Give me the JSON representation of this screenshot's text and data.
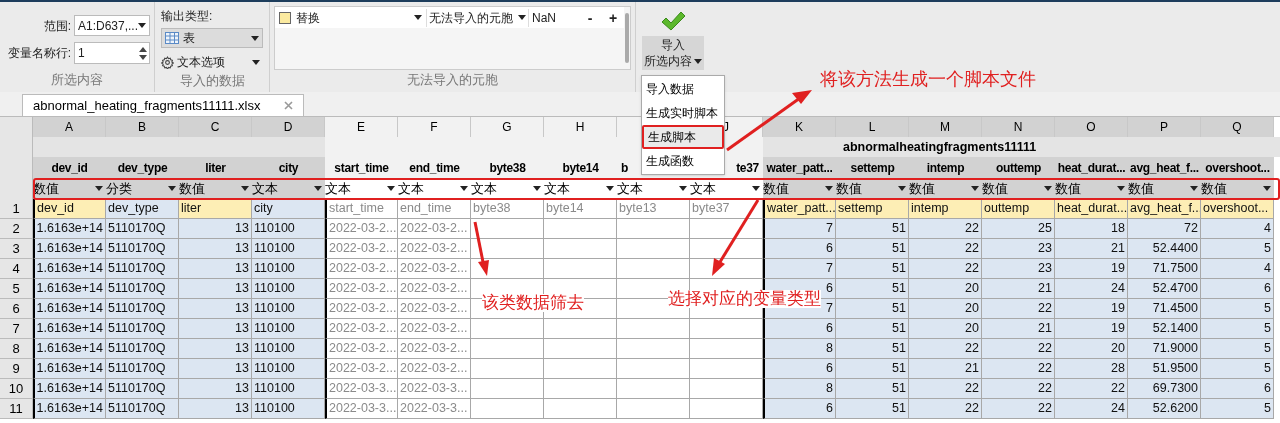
{
  "selection": {
    "title": "所选内容",
    "range_label": "范围:",
    "range_value": "A1:D637,...",
    "varnames_label": "变量名称行:",
    "varnames_value": "1"
  },
  "imported_data": {
    "title": "导入的数据",
    "output_label": "输出类型:",
    "output_value": "表",
    "text_options": "文本选项"
  },
  "unimportable": {
    "title": "无法导入的元胞",
    "rules": [
      {
        "action": "替换",
        "target": "无法导入的元胞",
        "value": "NaN",
        "color": "#fbeaa0"
      }
    ],
    "minus": "-",
    "plus": "+"
  },
  "import_button": {
    "line1": "导入",
    "line2": "所选内容"
  },
  "import_menu": {
    "items": [
      {
        "label": "导入数据",
        "selected": false
      },
      {
        "label": "生成实时脚本",
        "selected": false
      },
      {
        "label": "生成脚本",
        "selected": true
      },
      {
        "label": "生成函数",
        "selected": false
      }
    ]
  },
  "file_tabs": [
    {
      "label": "abnormal_heating_fragments11111.xlsx",
      "selected": true
    }
  ],
  "table": {
    "title": "abnormalheatingfragments11111",
    "columns": [
      {
        "letter": "A",
        "name": "dev_id",
        "type": "数值",
        "kind": "numeric",
        "selected": true
      },
      {
        "letter": "B",
        "name": "dev_type",
        "type": "分类",
        "kind": "text",
        "selected": true
      },
      {
        "letter": "C",
        "name": "liter",
        "type": "数值",
        "kind": "numeric",
        "selected": true
      },
      {
        "letter": "D",
        "name": "city",
        "type": "文本",
        "kind": "text",
        "selected": true
      },
      {
        "letter": "E",
        "name": "start_time",
        "type": "文本",
        "kind": "text",
        "selected": false
      },
      {
        "letter": "F",
        "name": "end_time",
        "type": "文本",
        "kind": "text",
        "selected": false
      },
      {
        "letter": "G",
        "name": "byte38",
        "type": "文本",
        "kind": "text",
        "selected": false
      },
      {
        "letter": "H",
        "name": "byte14",
        "type": "文本",
        "kind": "text",
        "selected": false
      },
      {
        "name": "b",
        "type": "文本",
        "kind": "text",
        "selected": false
      },
      {
        "letter": "J",
        "name": "te37",
        "type": "文本",
        "kind": "text",
        "selected": false
      },
      {
        "letter": "K",
        "name": "water_patt...",
        "type": "数值",
        "kind": "numeric",
        "selected": true
      },
      {
        "letter": "L",
        "name": "settemp",
        "type": "数值",
        "kind": "numeric",
        "selected": true
      },
      {
        "letter": "M",
        "name": "intemp",
        "type": "数值",
        "kind": "numeric",
        "selected": true
      },
      {
        "letter": "N",
        "name": "outtemp",
        "type": "数值",
        "kind": "numeric",
        "selected": true
      },
      {
        "letter": "O",
        "name": "heat_durat...",
        "type": "数值",
        "kind": "numeric",
        "selected": true
      },
      {
        "letter": "P",
        "name": "avg_heat_f...",
        "type": "数值",
        "kind": "numeric",
        "selected": true
      },
      {
        "letter": "Q",
        "name": "overshoot...",
        "type": "数值",
        "kind": "numeric",
        "selected": true
      }
    ],
    "rows": [
      {
        "number": "1",
        "kind": "names",
        "cells": [
          "dev_id",
          "dev_type",
          "liter",
          "city",
          "start_time",
          "end_time",
          "byte38",
          "byte14",
          "byte13",
          "byte37",
          "water_patt...",
          "settemp",
          "intemp",
          "outtemp",
          "heat_durat...",
          "avg_heat_f...",
          "overshoot..."
        ]
      },
      {
        "number": "2",
        "kind": "data",
        "cells": [
          "1.6163e+14",
          "5110170Q",
          "13",
          "110100",
          "2022-03-2...",
          "2022-03-2...",
          null,
          null,
          null,
          null,
          "7",
          "51",
          "22",
          "25",
          "18",
          "72",
          "4"
        ]
      },
      {
        "number": "3",
        "kind": "data",
        "cells": [
          "1.6163e+14",
          "5110170Q",
          "13",
          "110100",
          "2022-03-2...",
          "2022-03-2...",
          null,
          null,
          null,
          null,
          "6",
          "51",
          "22",
          "23",
          "21",
          "52.4400",
          "5"
        ]
      },
      {
        "number": "4",
        "kind": "data",
        "cells": [
          "1.6163e+14",
          "5110170Q",
          "13",
          "110100",
          "2022-03-2...",
          "2022-03-2...",
          null,
          null,
          null,
          null,
          "7",
          "51",
          "22",
          "23",
          "19",
          "71.7500",
          "4"
        ]
      },
      {
        "number": "5",
        "kind": "data",
        "cells": [
          "1.6163e+14",
          "5110170Q",
          "13",
          "110100",
          "2022-03-2...",
          "2022-03-2...",
          null,
          null,
          null,
          null,
          "6",
          "51",
          "20",
          "21",
          "24",
          "52.4700",
          "6"
        ]
      },
      {
        "number": "6",
        "kind": "data",
        "cells": [
          "1.6163e+14",
          "5110170Q",
          "13",
          "110100",
          "2022-03-2...",
          "2022-03-2...",
          null,
          null,
          null,
          null,
          "7",
          "51",
          "20",
          "22",
          "19",
          "71.4500",
          "5"
        ]
      },
      {
        "number": "7",
        "kind": "data",
        "cells": [
          "1.6163e+14",
          "5110170Q",
          "13",
          "110100",
          "2022-03-2...",
          "2022-03-2...",
          null,
          null,
          null,
          null,
          "6",
          "51",
          "20",
          "21",
          "19",
          "52.1400",
          "5"
        ]
      },
      {
        "number": "8",
        "kind": "data",
        "cells": [
          "1.6163e+14",
          "5110170Q",
          "13",
          "110100",
          "2022-03-2...",
          "2022-03-2...",
          null,
          null,
          null,
          null,
          "8",
          "51",
          "22",
          "22",
          "20",
          "71.9000",
          "5"
        ]
      },
      {
        "number": "9",
        "kind": "data",
        "cells": [
          "1.6163e+14",
          "5110170Q",
          "13",
          "110100",
          "2022-03-2...",
          "2022-03-2...",
          null,
          null,
          null,
          null,
          "6",
          "51",
          "21",
          "22",
          "28",
          "51.9500",
          "5"
        ]
      },
      {
        "number": "10",
        "kind": "data",
        "cells": [
          "1.6163e+14",
          "5110170Q",
          "13",
          "110100",
          "2022-03-3...",
          "2022-03-3...",
          null,
          null,
          null,
          null,
          "8",
          "51",
          "22",
          "22",
          "22",
          "69.7300",
          "6"
        ]
      },
      {
        "number": "11",
        "kind": "data",
        "cells": [
          "1.6163e+14",
          "5110170Q",
          "13",
          "110100",
          "2022-03-3...",
          "2022-03-3...",
          null,
          null,
          null,
          null,
          "6",
          "51",
          "22",
          "22",
          "24",
          "52.6200",
          "5"
        ]
      }
    ]
  },
  "annotations": [
    {
      "text": "将该方法生成一个脚本文件"
    },
    {
      "text": "该类数据筛去"
    },
    {
      "text": "选择对应的变量类型"
    }
  ]
}
